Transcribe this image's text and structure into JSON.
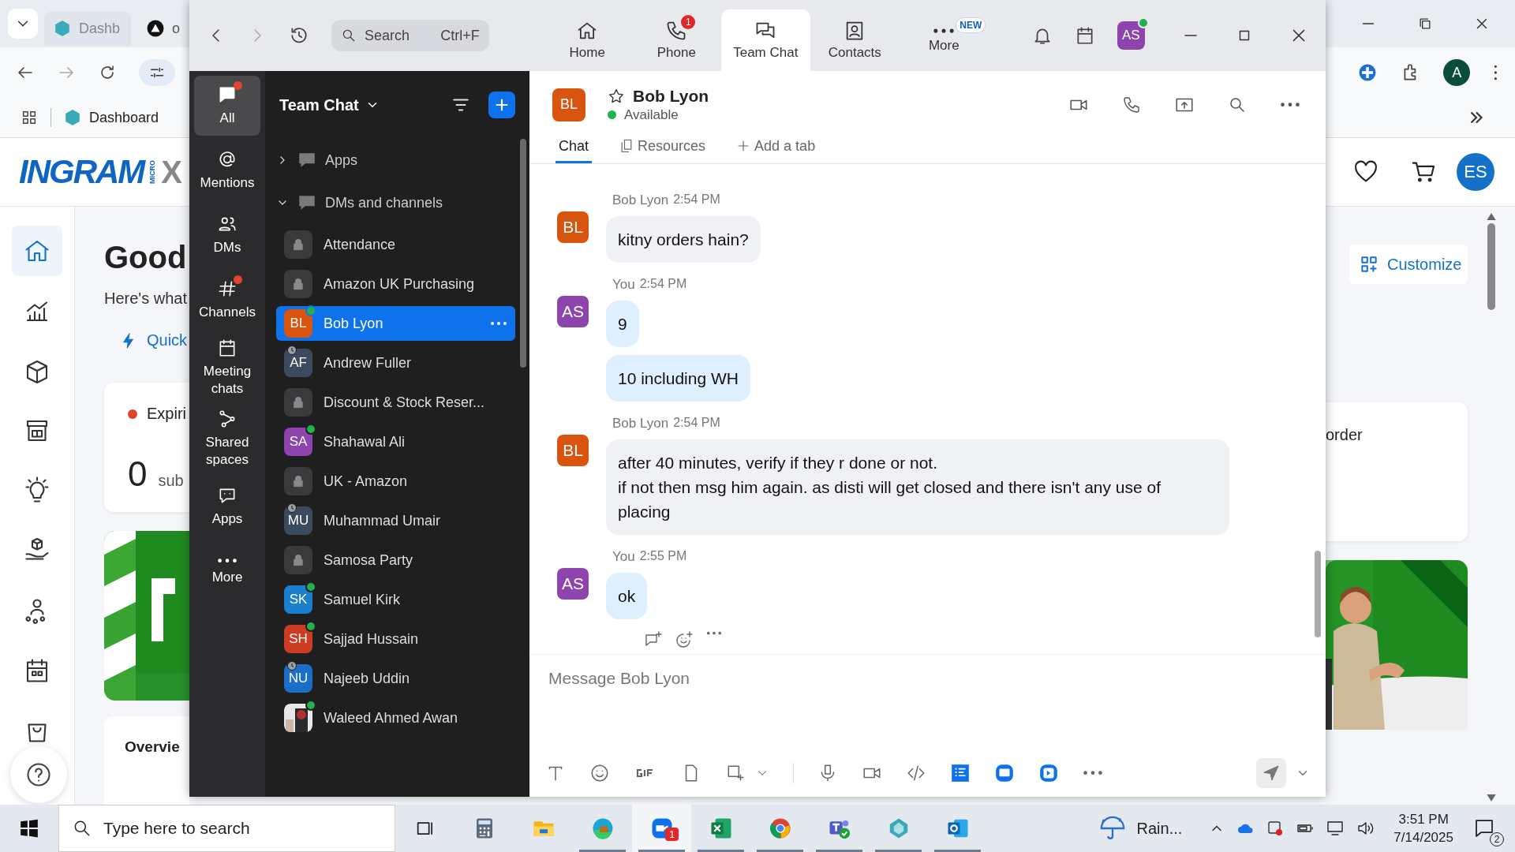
{
  "browser": {
    "tabs": [
      {
        "label": "Dashb",
        "selected": true
      },
      {
        "label": "o",
        "selected": false
      }
    ],
    "bookmarks": [
      {
        "label": "Dashboard"
      }
    ],
    "profile": "A"
  },
  "site": {
    "logo": "INGRAM",
    "logo_sub": "MICRO",
    "logo_tail": "X",
    "avatar": "ES",
    "customize": "Customize",
    "nav": [
      {
        "selected": true
      },
      {
        "selected": false
      },
      {
        "selected": false
      },
      {
        "selected": false
      },
      {
        "selected": false
      },
      {
        "selected": false
      },
      {
        "selected": false
      },
      {
        "selected": false
      },
      {
        "selected": false
      }
    ],
    "greeting": "Good",
    "subtitle": "Here's what",
    "quick_link": "Quick",
    "card": {
      "color": "#e0452b",
      "title": "Expiri",
      "count": "0",
      "unit": "sub"
    },
    "right_card": "order",
    "overview": "Overvie"
  },
  "zoom": {
    "search": {
      "placeholder": "Search",
      "shortcut": "Ctrl+F"
    },
    "nav": [
      {
        "label": "Home",
        "selected": false
      },
      {
        "label": "Phone",
        "selected": false,
        "badge": "1"
      },
      {
        "label": "Team Chat",
        "selected": true
      },
      {
        "label": "Contacts",
        "selected": false
      },
      {
        "label": "More",
        "selected": false,
        "tag": "NEW"
      }
    ],
    "user": {
      "initials": "AS",
      "color": "#8e44ad",
      "online": true
    }
  },
  "rail": [
    {
      "label": "All",
      "selected": true,
      "unread": true
    },
    {
      "label": "Mentions",
      "selected": false,
      "unread": false
    },
    {
      "label": "DMs",
      "selected": false,
      "unread": false
    },
    {
      "label": "Channels",
      "selected": false,
      "unread": true
    },
    {
      "label": "Meeting chats",
      "selected": false,
      "unread": false
    },
    {
      "label": "Shared spaces",
      "selected": false,
      "unread": false
    },
    {
      "label": "Apps",
      "selected": false,
      "unread": false
    },
    {
      "label": "More",
      "selected": false,
      "unread": false
    }
  ],
  "chat_list": {
    "title": "Team Chat",
    "sections": [
      {
        "label": "Apps",
        "expanded": false
      },
      {
        "label": "DMs and channels",
        "expanded": true
      }
    ],
    "items": [
      {
        "kind": "channel",
        "name": "Attendance",
        "selected": false
      },
      {
        "kind": "channel",
        "name": "Amazon UK Purchasing",
        "selected": false
      },
      {
        "kind": "person",
        "name": "Bob Lyon",
        "initials": "BL",
        "color": "#d9540f",
        "online": true,
        "selected": true
      },
      {
        "kind": "person",
        "name": "Andrew Fuller",
        "initials": "AF",
        "color": "#3b4a5c",
        "online": false,
        "selected": false
      },
      {
        "kind": "channel",
        "name": "Discount & Stock Reser...",
        "selected": false
      },
      {
        "kind": "person",
        "name": "Shahawal Ali",
        "initials": "SA",
        "color": "#8e44ad",
        "online": true,
        "selected": false
      },
      {
        "kind": "channel",
        "name": "UK - Amazon",
        "selected": false
      },
      {
        "kind": "person",
        "name": "Muhammad Umair",
        "initials": "MU",
        "color": "#3b4a5c",
        "online": false,
        "selected": false
      },
      {
        "kind": "channel",
        "name": "Samosa Party",
        "selected": false
      },
      {
        "kind": "person",
        "name": "Samuel Kirk",
        "initials": "SK",
        "color": "#1b7fd0",
        "online": true,
        "selected": false
      },
      {
        "kind": "person",
        "name": "Sajjad Hussain",
        "initials": "SH",
        "color": "#cc3b22",
        "online": true,
        "selected": false
      },
      {
        "kind": "person",
        "name": "Najeeb Uddin",
        "initials": "NU",
        "color": "#1b6fc9",
        "online": false,
        "selected": false
      },
      {
        "name": "Waleed Ahmed Awan",
        "online": true,
        "selected": false
      }
    ]
  },
  "conversation": {
    "name": "Bob Lyon",
    "initials": "BL",
    "color": "#d9540f",
    "status": "Available",
    "tabs": [
      {
        "kind": "plain",
        "label": "Chat",
        "selected": true
      },
      {
        "kind": "files",
        "label": "Resources",
        "selected": false
      },
      {
        "kind": "add",
        "label": "Add a tab",
        "selected": false
      }
    ],
    "messages": [
      {
        "sender": "Bob Lyon",
        "time": "2:54 PM",
        "initials": "BL",
        "color": "#d9540f",
        "mine": false,
        "bubbles": [
          "kitny orders hain?"
        ]
      },
      {
        "sender": "You",
        "time": "2:54 PM",
        "initials": "AS",
        "color": "#8e44ad",
        "mine": true,
        "bubbles": [
          "9",
          "10 including WH"
        ]
      },
      {
        "sender": "Bob Lyon",
        "time": "2:54 PM",
        "initials": "BL",
        "color": "#d9540f",
        "mine": false,
        "bubbles": [
          "after 40 minutes, verify if they r done or not.\nif not then msg him again. as disti will get closed and there isn't any use of placing"
        ]
      },
      {
        "sender": "You",
        "time": "2:55 PM",
        "initials": "AS",
        "color": "#8e44ad",
        "mine": true,
        "bubbles": [
          "ok"
        ]
      }
    ],
    "composer": {
      "placeholder": "Message Bob Lyon"
    }
  },
  "taskbar": {
    "search_placeholder": "Type here to search",
    "apps": [
      {
        "open": false,
        "active": false
      },
      {
        "open": false,
        "active": false
      },
      {
        "open": false,
        "active": false
      },
      {
        "open": true,
        "active": false
      },
      {
        "open": true,
        "active": true,
        "badge": "1"
      },
      {
        "open": true,
        "active": false
      },
      {
        "open": true,
        "active": false
      },
      {
        "open": true,
        "active": false
      },
      {
        "open": true,
        "active": false
      },
      {
        "open": true,
        "active": false
      }
    ],
    "weather": "Rain...",
    "time": "3:51 PM",
    "date": "7/14/2025",
    "notifications": "2"
  }
}
